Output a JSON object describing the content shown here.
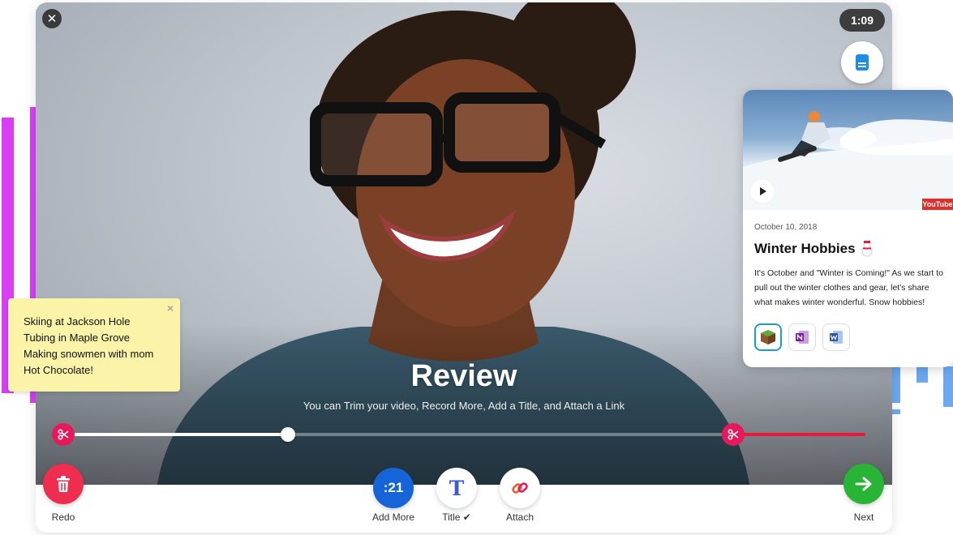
{
  "colors": {
    "accent_pink": "#e8195a",
    "trim_red": "#e8193c",
    "delete_red": "#ef2d4e",
    "counter_blue": "#1565d8",
    "next_green": "#28b535",
    "sticky_yellow": "#fbf4a8",
    "deco_purple": "#d93ef5",
    "deco_blue": "#6aa9f2"
  },
  "icons": {
    "close": "close-icon",
    "notes": "notes-icon",
    "scissors": "scissors-icon",
    "trash": "trash-icon",
    "text_t": "text-t-icon",
    "link": "link-icon",
    "arrow": "arrow-right-icon",
    "play": "play-icon",
    "snowman": "snowman-icon",
    "minecraft": "minecraft-icon",
    "onenote": "onenote-icon",
    "word": "word-icon"
  },
  "recorder": {
    "timer": "1:09",
    "review_title": "Review",
    "review_subtitle": "You can Trim your video, Record More, Add a Title, and Attach a Link",
    "playhead_fraction": 0.27,
    "trim_start_fraction": 0.0,
    "trim_end_fraction": 0.84
  },
  "actions": {
    "redo_label": "Redo",
    "add_more_counter": ":21",
    "add_more_label": "Add More",
    "title_label": "Title ✔",
    "attach_label": "Attach",
    "next_label": "Next"
  },
  "sticky_note": {
    "lines": [
      "Skiing at Jackson Hole",
      "Tubing in Maple Grove",
      "Making snowmen with mom",
      "Hot Chocolate!"
    ],
    "close_glyph": "×"
  },
  "post": {
    "date": "October 10, 2018",
    "title": "Winter Hobbies",
    "body": "It's October and \"Winter is Coming!\" As we start to pull out the winter clothes and gear, let's share what makes winter wonderful. Snow hobbies!",
    "video_badge": "YouTube",
    "attachments": [
      "Minecraft",
      "OneNote",
      "Word"
    ]
  }
}
